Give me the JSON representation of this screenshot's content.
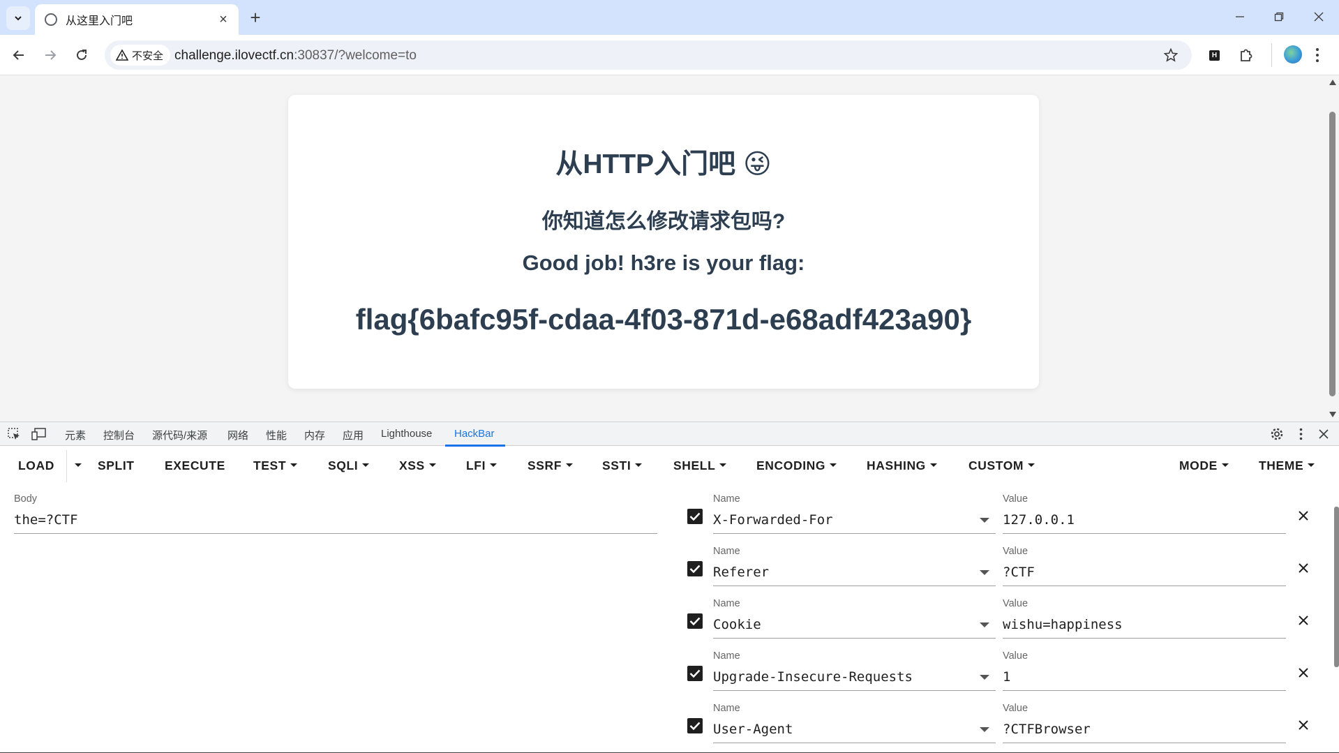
{
  "browser": {
    "tab_title": "从这里入门吧",
    "security_label": "不安全",
    "url_host": "challenge.ilovectf.cn",
    "url_rest": ":30837/?welcome=to"
  },
  "page": {
    "heading": "从HTTP入门吧",
    "heading_emoji": "😜",
    "subheading": "你知道怎么修改请求包吗?",
    "good_job": "Good job! h3re is your flag:",
    "flag": "flag{6bafc95f-cdaa-4f03-871d-e68adf423a90}"
  },
  "devtools": {
    "tabs": [
      "元素",
      "控制台",
      "源代码/来源",
      "网络",
      "性能",
      "内存",
      "应用",
      "Lighthouse",
      "HackBar"
    ],
    "active_tab": "HackBar"
  },
  "hackbar": {
    "menu": {
      "load": "LOAD",
      "split": "SPLIT",
      "execute": "EXECUTE",
      "test": "TEST",
      "sqli": "SQLI",
      "xss": "XSS",
      "lfi": "LFI",
      "ssrf": "SSRF",
      "ssti": "SSTI",
      "shell": "SHELL",
      "encoding": "ENCODING",
      "hashing": "HASHING",
      "custom": "CUSTOM",
      "mode": "MODE",
      "theme": "THEME"
    },
    "body_label": "Body",
    "body_value": "the=?CTF",
    "name_label": "Name",
    "value_label": "Value",
    "headers": [
      {
        "name": "X-Forwarded-For",
        "value": "127.0.0.1",
        "enabled": true
      },
      {
        "name": "Referer",
        "value": "?CTF",
        "enabled": true
      },
      {
        "name": "Cookie",
        "value": "wishu=happiness",
        "enabled": true
      },
      {
        "name": "Upgrade-Insecure-Requests",
        "value": "1",
        "enabled": true
      },
      {
        "name": "User-Agent",
        "value": "?CTFBrowser",
        "enabled": true
      }
    ]
  }
}
